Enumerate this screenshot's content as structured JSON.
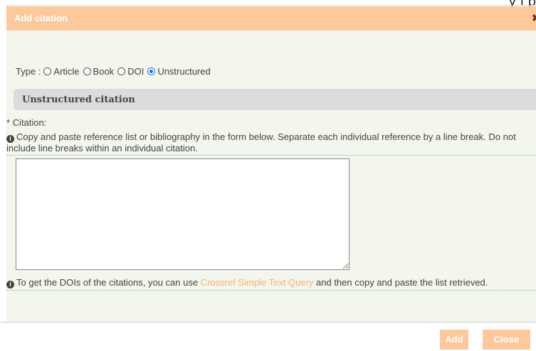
{
  "header": {
    "title": "Add citation",
    "close_glyph": "✖",
    "top_cut_text": "y i p"
  },
  "type_selector": {
    "label": "Type :",
    "options": [
      {
        "label": "Article",
        "checked": false
      },
      {
        "label": "Book",
        "checked": false
      },
      {
        "label": "DOI",
        "checked": false
      },
      {
        "label": "Unstructured",
        "checked": true
      }
    ]
  },
  "section": {
    "title": "Unstructured citation"
  },
  "citation": {
    "label": "* Citation:",
    "help_text": "Copy and paste reference list or bibliography in the form below. Separate each individual reference by a line break. Do not include line breaks within an individual citation.",
    "value": ""
  },
  "doi_help": {
    "prefix": "To get the DOIs of the citations, you can use ",
    "link_text": "Crossref Simple Text Query",
    "suffix": " and then copy and paste the list retrieved."
  },
  "buttons": {
    "add": "Add",
    "close": "Close"
  },
  "colors": {
    "header": "#fdc89a",
    "body": "#f2f6ec",
    "link": "#fbb36f",
    "radio_checked": "#1a73e8"
  },
  "icons": {
    "info": "info-circle-icon",
    "close": "close-icon"
  }
}
